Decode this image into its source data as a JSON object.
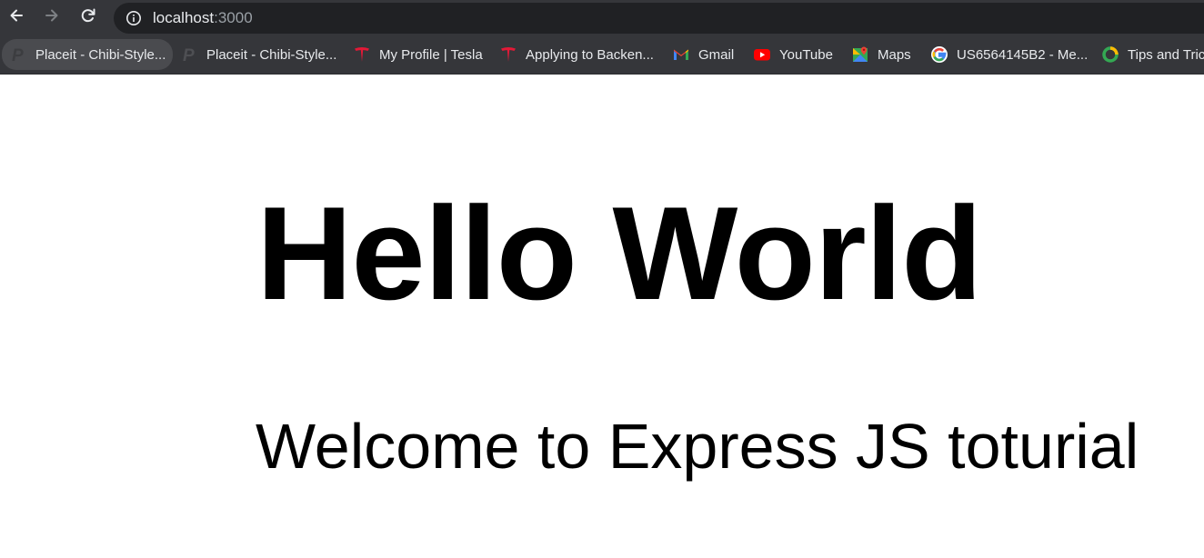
{
  "browser": {
    "url_host": "localhost",
    "url_port": ":3000"
  },
  "bookmarks": [
    {
      "label": "Placeit - Chibi-Style...",
      "icon": "placeit-icon"
    },
    {
      "label": "Placeit - Chibi-Style...",
      "icon": "placeit-icon"
    },
    {
      "label": "My Profile | Tesla",
      "icon": "tesla-icon"
    },
    {
      "label": "Applying to Backen...",
      "icon": "tesla-icon"
    },
    {
      "label": "Gmail",
      "icon": "gmail-icon"
    },
    {
      "label": "YouTube",
      "icon": "youtube-icon"
    },
    {
      "label": "Maps",
      "icon": "maps-icon"
    },
    {
      "label": "US6564145B2 - Me...",
      "icon": "google-icon"
    },
    {
      "label": "Tips and Tric",
      "icon": "ring-icon"
    }
  ],
  "page": {
    "heading": "Hello World",
    "subheading": "Welcome to Express JS toturial"
  },
  "colors": {
    "chrome_bg": "#35363a",
    "omnibox_bg": "#202124",
    "tesla_red": "#e31937",
    "youtube_red": "#ff0000"
  }
}
